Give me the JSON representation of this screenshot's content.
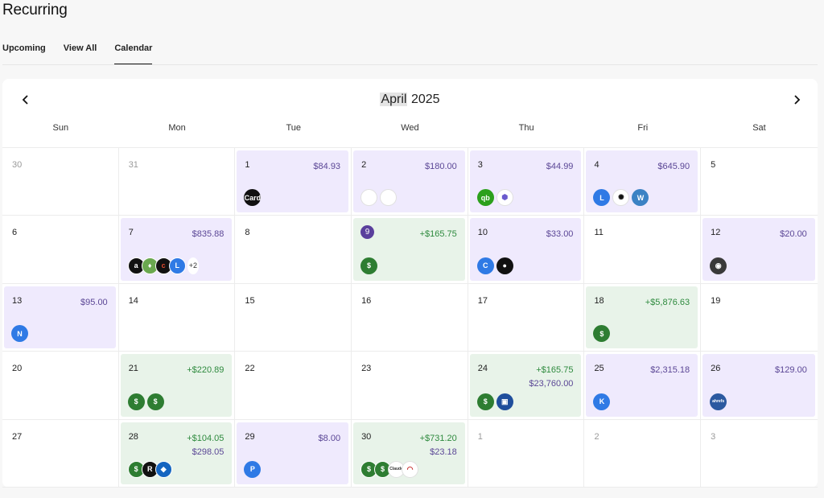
{
  "header": {
    "title": "Recurring"
  },
  "tabs": [
    {
      "label": "Upcoming",
      "active": false
    },
    {
      "label": "View All",
      "active": false
    },
    {
      "label": "Calendar",
      "active": true
    }
  ],
  "calendar": {
    "month": "April",
    "year": "2025",
    "weekdays": [
      "Sun",
      "Mon",
      "Tue",
      "Wed",
      "Thu",
      "Fri",
      "Sat"
    ],
    "colors": {
      "expense_bg": "#efeafd",
      "income_bg": "#e8f3e9",
      "expense_text": "#5b4796",
      "income_text": "#2e8a3e"
    },
    "cells": [
      {
        "day": "30",
        "muted": true,
        "type": "",
        "amounts": [],
        "icons": []
      },
      {
        "day": "31",
        "muted": true,
        "type": "",
        "amounts": [],
        "icons": []
      },
      {
        "day": "1",
        "type": "purple",
        "amounts": [
          {
            "text": "$84.93",
            "kind": "neg"
          }
        ],
        "icons": [
          {
            "name": "apple-card-icon",
            "bg": "#111111",
            "text": "Card"
          }
        ]
      },
      {
        "day": "2",
        "type": "purple",
        "amounts": [
          {
            "text": "$180.00",
            "kind": "neg"
          }
        ],
        "icons": [
          {
            "name": "merchant-logo-icon",
            "bg": "#ffffff",
            "text": ""
          },
          {
            "name": "merchant-logo-icon",
            "bg": "#ffffff",
            "text": ""
          }
        ]
      },
      {
        "day": "3",
        "type": "purple",
        "amounts": [
          {
            "text": "$44.99",
            "kind": "neg"
          }
        ],
        "icons": [
          {
            "name": "quickbooks-icon",
            "bg": "#2ca01c",
            "text": "qb"
          },
          {
            "name": "hexagon-logo-icon",
            "bg": "#ffffff",
            "text": "⬢",
            "fg": "#6a5acd"
          }
        ]
      },
      {
        "day": "4",
        "type": "purple",
        "amounts": [
          {
            "text": "$645.90",
            "kind": "neg"
          }
        ],
        "icons": [
          {
            "name": "letter-l-icon",
            "bg": "#2f7ae5",
            "text": "L"
          },
          {
            "name": "openai-icon",
            "bg": "#ffffff",
            "text": "✺",
            "fg": "#111111"
          },
          {
            "name": "letter-w-icon",
            "bg": "#3b82c4",
            "text": "W"
          }
        ]
      },
      {
        "day": "5",
        "type": "",
        "amounts": [],
        "icons": []
      },
      {
        "day": "6",
        "type": "",
        "amounts": [],
        "icons": []
      },
      {
        "day": "7",
        "type": "purple",
        "amounts": [
          {
            "text": "$835.88",
            "kind": "neg"
          }
        ],
        "icons": [
          {
            "name": "amazon-icon",
            "bg": "#111111",
            "text": "a"
          },
          {
            "name": "android-logo-icon",
            "bg": "#6aa84f",
            "text": "♦"
          },
          {
            "name": "letter-c-icon",
            "bg": "#111111",
            "text": "c",
            "fg": "#e04b2f"
          },
          {
            "name": "letter-l-icon",
            "bg": "#2f7ae5",
            "text": "L"
          }
        ],
        "more": "+2"
      },
      {
        "day": "8",
        "type": "",
        "amounts": [],
        "icons": []
      },
      {
        "day": "9",
        "badge": true,
        "type": "green",
        "amounts": [
          {
            "text": "+$165.75",
            "kind": "pos"
          }
        ],
        "icons": [
          {
            "name": "dollar-icon",
            "bg": "#2e7d32",
            "text": "$"
          }
        ]
      },
      {
        "day": "10",
        "type": "purple",
        "amounts": [
          {
            "text": "$33.00",
            "kind": "neg"
          }
        ],
        "icons": [
          {
            "name": "letter-c-icon",
            "bg": "#2f7ae5",
            "text": "C"
          },
          {
            "name": "github-icon",
            "bg": "#111111",
            "text": "●"
          }
        ]
      },
      {
        "day": "11",
        "type": "",
        "amounts": [],
        "icons": []
      },
      {
        "day": "12",
        "type": "purple",
        "amounts": [
          {
            "text": "$20.00",
            "kind": "neg"
          }
        ],
        "icons": [
          {
            "name": "dark-logo-icon",
            "bg": "#3a3a3a",
            "text": "◉"
          }
        ]
      },
      {
        "day": "13",
        "type": "purple",
        "amounts": [
          {
            "text": "$95.00",
            "kind": "neg"
          }
        ],
        "icons": [
          {
            "name": "letter-n-icon",
            "bg": "#2f7ae5",
            "text": "N"
          }
        ]
      },
      {
        "day": "14",
        "type": "",
        "amounts": [],
        "icons": []
      },
      {
        "day": "15",
        "type": "",
        "amounts": [],
        "icons": []
      },
      {
        "day": "16",
        "type": "",
        "amounts": [],
        "icons": []
      },
      {
        "day": "17",
        "type": "",
        "amounts": [],
        "icons": []
      },
      {
        "day": "18",
        "type": "green",
        "amounts": [
          {
            "text": "+$5,876.63",
            "kind": "pos"
          }
        ],
        "icons": [
          {
            "name": "dollar-icon",
            "bg": "#2e7d32",
            "text": "$"
          }
        ]
      },
      {
        "day": "19",
        "type": "",
        "amounts": [],
        "icons": []
      },
      {
        "day": "20",
        "type": "",
        "amounts": [],
        "icons": []
      },
      {
        "day": "21",
        "type": "green",
        "amounts": [
          {
            "text": "+$220.89",
            "kind": "pos"
          }
        ],
        "icons": [
          {
            "name": "dollar-icon",
            "bg": "#2e7d32",
            "text": "$"
          },
          {
            "name": "dollar-icon",
            "bg": "#2e7d32",
            "text": "$"
          }
        ]
      },
      {
        "day": "22",
        "type": "",
        "amounts": [],
        "icons": []
      },
      {
        "day": "23",
        "type": "",
        "amounts": [],
        "icons": []
      },
      {
        "day": "24",
        "type": "green",
        "amounts": [
          {
            "text": "+$165.75",
            "kind": "pos"
          },
          {
            "text": "$23,760.00",
            "kind": "neg"
          }
        ],
        "icons": [
          {
            "name": "dollar-icon",
            "bg": "#2e7d32",
            "text": "$"
          },
          {
            "name": "bank-logo-icon",
            "bg": "#1f4e9c",
            "text": "▣"
          }
        ]
      },
      {
        "day": "25",
        "type": "purple",
        "amounts": [
          {
            "text": "$2,315.18",
            "kind": "neg"
          }
        ],
        "icons": [
          {
            "name": "letter-k-icon",
            "bg": "#2f7ae5",
            "text": "K"
          }
        ]
      },
      {
        "day": "26",
        "type": "purple",
        "amounts": [
          {
            "text": "$129.00",
            "kind": "neg"
          }
        ],
        "icons": [
          {
            "name": "ahrefs-icon",
            "bg": "#2c5aa0",
            "text": "ahrefs",
            "small": true
          }
        ]
      },
      {
        "day": "27",
        "type": "",
        "amounts": [],
        "icons": []
      },
      {
        "day": "28",
        "type": "green",
        "amounts": [
          {
            "text": "+$104.05",
            "kind": "pos"
          },
          {
            "text": "$298.05",
            "kind": "neg"
          }
        ],
        "icons": [
          {
            "name": "dollar-icon",
            "bg": "#2e7d32",
            "text": "$"
          },
          {
            "name": "letter-r-icon",
            "bg": "#111111",
            "text": "R"
          },
          {
            "name": "blue-logo-icon",
            "bg": "#1565c0",
            "text": "◆"
          }
        ],
        "overlap": true
      },
      {
        "day": "29",
        "type": "purple",
        "amounts": [
          {
            "text": "$8.00",
            "kind": "neg"
          }
        ],
        "icons": [
          {
            "name": "letter-p-icon",
            "bg": "#2f7ae5",
            "text": "P"
          }
        ]
      },
      {
        "day": "30",
        "type": "green",
        "amounts": [
          {
            "text": "+$731.20",
            "kind": "pos"
          },
          {
            "text": "$23.18",
            "kind": "neg"
          }
        ],
        "icons": [
          {
            "name": "dollar-icon",
            "bg": "#2e7d32",
            "text": "$"
          },
          {
            "name": "dollar-icon",
            "bg": "#2e7d32",
            "text": "$"
          },
          {
            "name": "claude-icon",
            "bg": "#ffffff",
            "text": "Claude",
            "fg": "#333333",
            "small": true
          },
          {
            "name": "red-logo-icon",
            "bg": "#ffffff",
            "text": "◠",
            "fg": "#c62828"
          }
        ],
        "overlap": true
      },
      {
        "day": "1",
        "muted": true,
        "type": "",
        "amounts": [],
        "icons": []
      },
      {
        "day": "2",
        "muted": true,
        "type": "",
        "amounts": [],
        "icons": []
      },
      {
        "day": "3",
        "muted": true,
        "type": "",
        "amounts": [],
        "icons": []
      }
    ]
  }
}
